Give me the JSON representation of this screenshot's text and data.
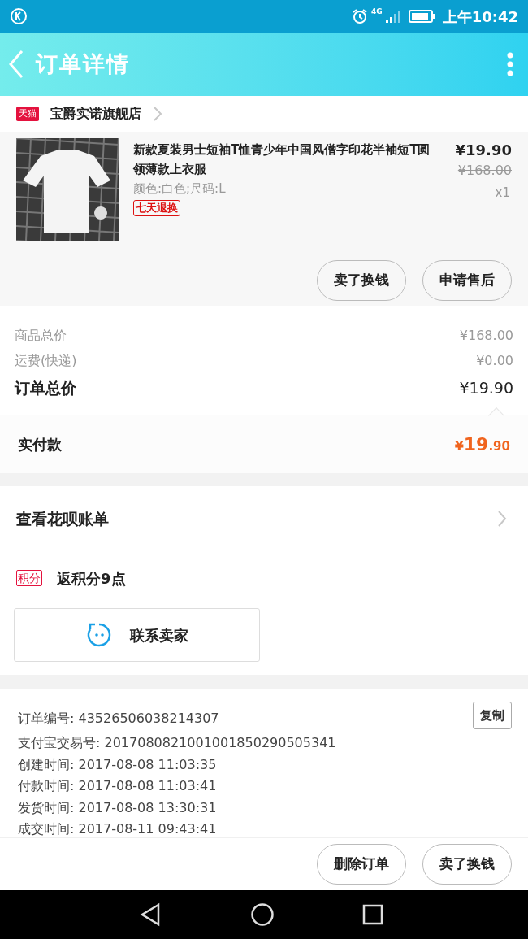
{
  "status_bar": {
    "network": "4G",
    "time": "上午10:42"
  },
  "header": {
    "title": "订单详情"
  },
  "store": {
    "badge": "天猫",
    "name": "宝爵实诺旗舰店"
  },
  "product": {
    "kind": "picture",
    "title": "新款夏装男士短袖T恤青少年中国风僧字印花半袖短T圆领薄款上衣服",
    "spec": "颜色:白色;尺码:L",
    "tag": "七天退换",
    "price": "¥19.90",
    "original_price": "¥168.00",
    "quantity": "x1",
    "buttons": [
      "卖了换钱",
      "申请售后"
    ]
  },
  "summary": [
    {
      "kind": "minor",
      "label": "商品总价",
      "value": "¥168.00"
    },
    {
      "kind": "minor",
      "label": "运费(快递)",
      "value": "¥0.00"
    },
    {
      "kind": "total",
      "label": "订单总价",
      "value": "¥19.90"
    }
  ],
  "paid": {
    "label": "实付款",
    "currency": "¥",
    "integer": "19",
    "decimal": ".90"
  },
  "huabei": {
    "label": "查看花呗账单"
  },
  "points": {
    "badge": "积分",
    "text": "返积分**9**点"
  },
  "contact_button": "联系卖家",
  "details": {
    "copy_button": "复制",
    "rows": [
      "订单编号: 43526506038214307",
      "支付宝交易号: 2017080821001001850290505341",
      "创建时间: 2017-08-08 11:03:35",
      "付款时间: 2017-08-08 11:03:41",
      "发货时间: 2017-08-08 13:30:31",
      "成交时间: 2017-08-11 09:43:41"
    ]
  },
  "footer_buttons": [
    "删除订单",
    "卖了换钱"
  ]
}
